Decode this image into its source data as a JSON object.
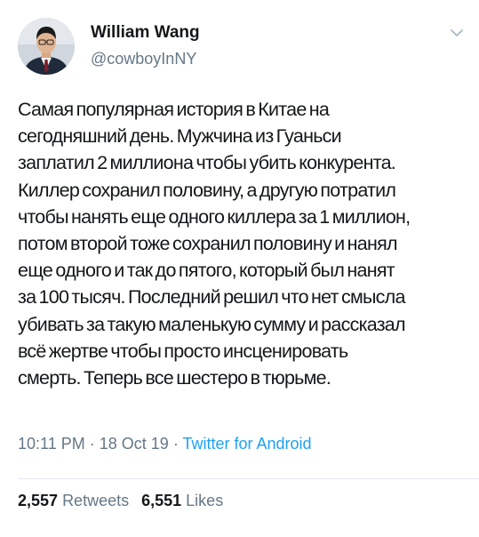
{
  "tweet": {
    "author": {
      "name": "William Wang",
      "handle": "@cowboyInNY",
      "avatar_icon": "user-avatar-photo"
    },
    "menu_icon": "chevron-down-icon",
    "text_lines": [
      "Самая популярная история в Китае на",
      "сегодняшний день. Мужчина из Гуаньси",
      "заплатил 2 миллиона чтобы убить конкурента.",
      "Киллер сохранил половину, а другую потратил",
      "чтобы нанять еще одного киллера за 1 миллион,",
      "потом второй тоже сохранил половину и нанял",
      "еще одного и так до пятого, который был нанят",
      "за 100 тысяч. Последний решил что нет смысла",
      "убивать за такую маленькую сумму и рассказал",
      "всё жертве чтобы просто инсценировать",
      "смерть. Теперь все шестеро в тюрьме."
    ],
    "meta": {
      "time": "10:11 PM",
      "separator": "·",
      "date": "18 Oct 19",
      "source": "Twitter for Android"
    },
    "stats": {
      "retweets_count": "2,557",
      "retweets_label": "Retweets",
      "likes_count": "6,551",
      "likes_label": "Likes"
    },
    "colors": {
      "text": "#14171a",
      "secondary": "#657786",
      "link": "#1da1f2",
      "divider": "#e1e8ed"
    }
  }
}
